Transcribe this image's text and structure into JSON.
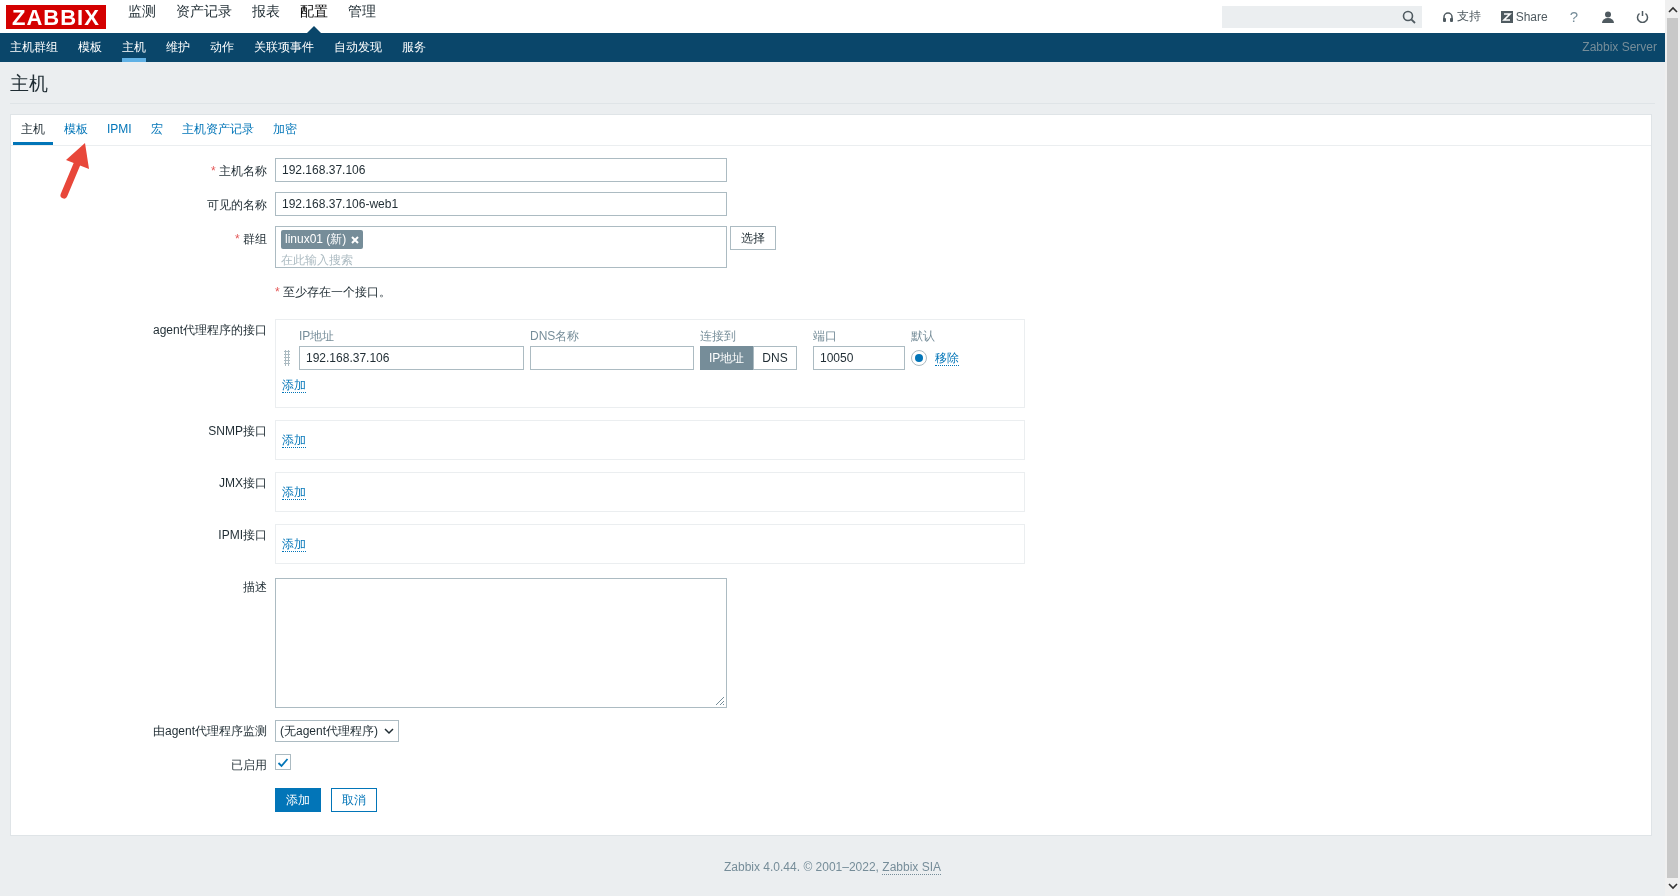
{
  "header": {
    "logo": "ZABBIX",
    "main_menu": [
      {
        "label": "监测",
        "selected": false
      },
      {
        "label": "资产记录",
        "selected": false
      },
      {
        "label": "报表",
        "selected": false
      },
      {
        "label": "配置",
        "selected": true
      },
      {
        "label": "管理",
        "selected": false
      }
    ],
    "links": [
      {
        "kind": "support",
        "label": "支持"
      },
      {
        "kind": "share",
        "label": "Share"
      },
      {
        "kind": "help",
        "label": "?"
      },
      {
        "kind": "profile"
      },
      {
        "kind": "logout"
      }
    ]
  },
  "sub_menu": [
    {
      "label": "主机群组",
      "selected": false
    },
    {
      "label": "模板",
      "selected": false
    },
    {
      "label": "主机",
      "selected": true
    },
    {
      "label": "维护",
      "selected": false
    },
    {
      "label": "动作",
      "selected": false
    },
    {
      "label": "关联项事件",
      "selected": false
    },
    {
      "label": "自动发现",
      "selected": false
    },
    {
      "label": "服务",
      "selected": false
    }
  ],
  "server_name": "Zabbix Server",
  "page_title": "主机",
  "tabs": [
    {
      "label": "主机",
      "selected": true
    },
    {
      "label": "模板",
      "selected": false
    },
    {
      "label": "IPMI",
      "selected": false
    },
    {
      "label": "宏",
      "selected": false
    },
    {
      "label": "主机资产记录",
      "selected": false
    },
    {
      "label": "加密",
      "selected": false
    }
  ],
  "form": [
    {
      "kind": "text",
      "label": "主机名称",
      "required_mark": "*",
      "value": "192.168.37.106"
    },
    {
      "kind": "text",
      "label": "可见的名称",
      "value": "192.168.37.106-web1"
    },
    {
      "kind": "multiselect",
      "label": "群组",
      "required_mark": "*",
      "tags": [
        "linux01 (新)"
      ],
      "placeholder": "在此输入搜索",
      "button": "选择"
    },
    {
      "kind": "note",
      "required_mark": "*",
      "text": "至少存在一个接口。"
    },
    {
      "kind": "interface",
      "label": "agent代理程序的接口",
      "columns": [
        "IP地址",
        "DNS名称",
        "连接到",
        "端口",
        "默认"
      ],
      "rows": [
        {
          "ip": "192.168.37.106",
          "connect": [
            {
              "label": "IP地址",
              "selected": true
            },
            {
              "label": "DNS",
              "selected": false
            }
          ],
          "port": "10050",
          "default": true,
          "remove": "移除"
        }
      ],
      "add": "添加"
    },
    {
      "kind": "interface",
      "label": "SNMP接口",
      "add": "添加"
    },
    {
      "kind": "interface",
      "label": "JMX接口",
      "add": "添加"
    },
    {
      "kind": "interface",
      "label": "IPMI接口",
      "add": "添加"
    },
    {
      "kind": "textarea",
      "label": "描述"
    },
    {
      "kind": "select",
      "label": "由agent代理程序监测",
      "value": "(无agent代理程序)"
    },
    {
      "kind": "checkbox",
      "label": "已启用",
      "checked": true
    },
    {
      "kind": "buttons",
      "buttons": [
        {
          "label": "添加",
          "primary": true
        },
        {
          "label": "取消",
          "primary": false
        }
      ]
    }
  ],
  "footer": {
    "text": "Zabbix 4.0.44. © 2001–2022, ",
    "link": "Zabbix SIA"
  }
}
